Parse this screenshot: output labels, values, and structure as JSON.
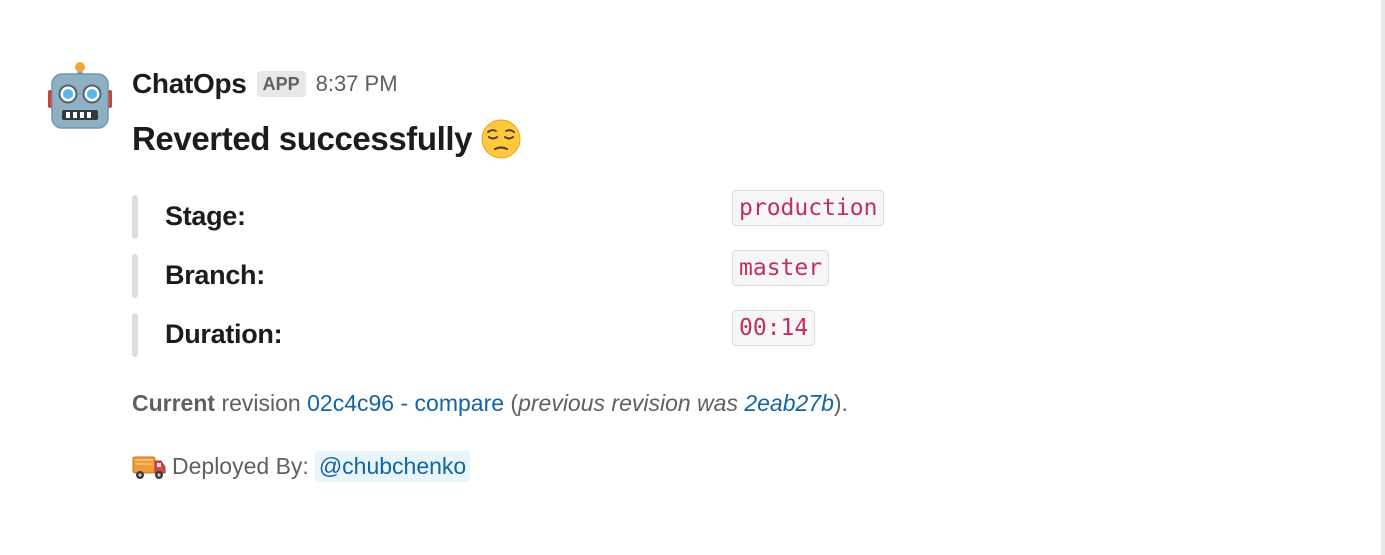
{
  "message": {
    "sender": "ChatOps",
    "badge": "APP",
    "time": "8:37 PM",
    "avatar_icon": "robot-icon",
    "title": "Reverted successfully",
    "title_emoji": "pensive-face-icon"
  },
  "fields": [
    {
      "label": "Stage:",
      "value": "production"
    },
    {
      "label": "Branch:",
      "value": "master"
    },
    {
      "label": "Duration:",
      "value": "00:14"
    }
  ],
  "revision": {
    "current_label": "Current",
    "revision_word": "revision",
    "current_rev": "02c4c96",
    "separator": "-",
    "compare_label": "compare",
    "previous_prefix": "previous revision was",
    "previous_rev": "2eab27b"
  },
  "deployed": {
    "icon": "truck-icon",
    "label": "Deployed By:",
    "user": "@chubchenko"
  },
  "colors": {
    "link": "#1264a3",
    "code": "#c0325a",
    "mention_bg": "#e8f5fa"
  }
}
